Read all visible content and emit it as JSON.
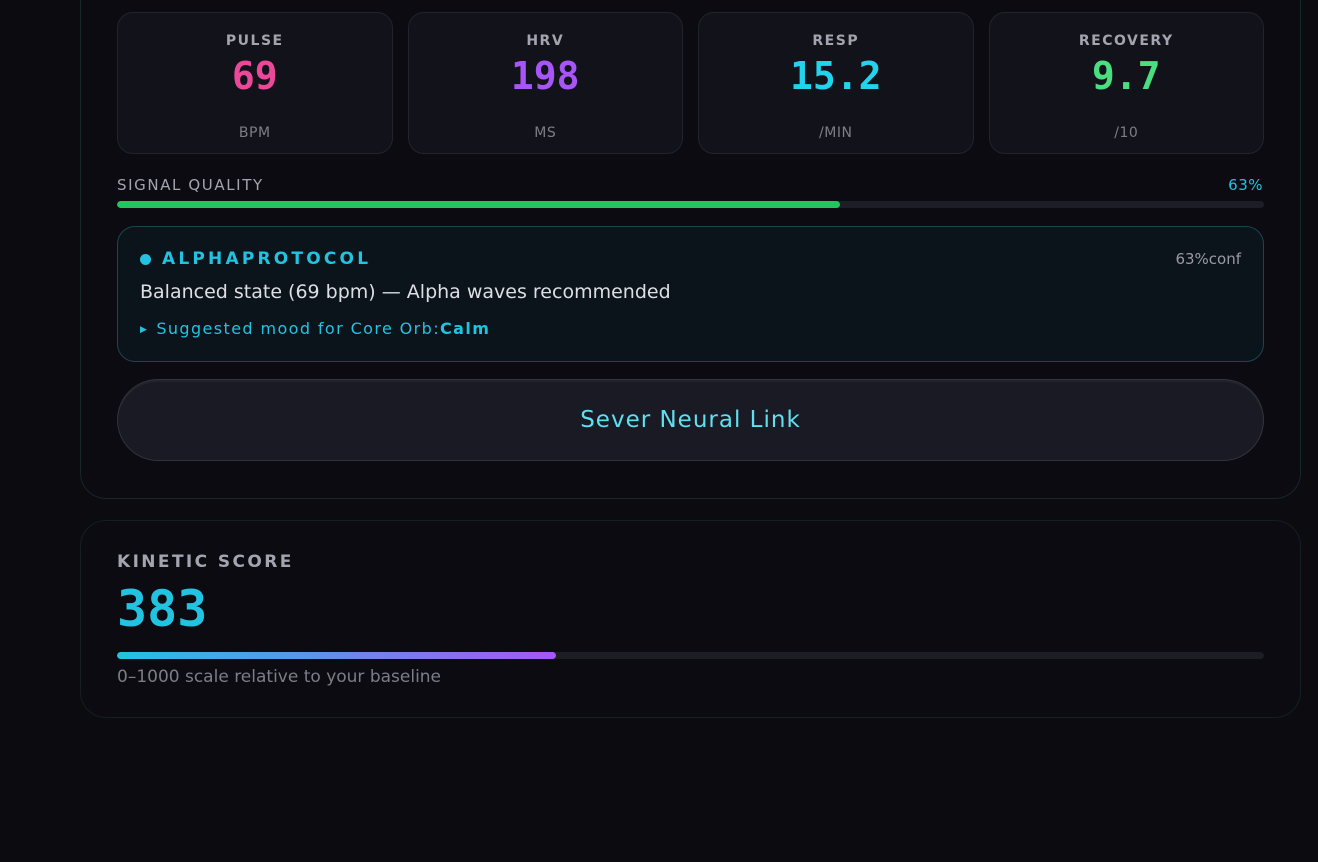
{
  "metrics": [
    {
      "label": "PULSE",
      "value": "69",
      "unit": "BPM",
      "color": "#ec4899"
    },
    {
      "label": "HRV",
      "value": "198",
      "unit": "MS",
      "color": "#a855f7"
    },
    {
      "label": "RESP",
      "value": "15.2",
      "unit": "/MIN",
      "color": "#22d3ee"
    },
    {
      "label": "RECOVERY",
      "value": "9.7",
      "unit": "/10",
      "color": "#4ade80"
    }
  ],
  "signal_quality": {
    "label": "SIGNAL QUALITY",
    "value_text": "63%",
    "percent": 63,
    "color": "#22c55e"
  },
  "protocol": {
    "name": "ALPHAPROTOCOL",
    "confidence": "63%conf",
    "description": "Balanced state (69 bpm) — Alpha waves recommended",
    "suggestion_prefix": "Suggested mood for Core Orb:",
    "suggestion_mood": "Calm",
    "accent": "#22c3e0"
  },
  "actions": {
    "sever_label": "Sever Neural Link"
  },
  "kinetic": {
    "label": "KINETIC SCORE",
    "value": "383",
    "score": 383,
    "max": 1000,
    "caption": "0–1000 scale relative to your baseline"
  },
  "icons": {
    "status_dot": "status-dot-icon",
    "suggestion_arrow": "triangle-right-icon"
  }
}
